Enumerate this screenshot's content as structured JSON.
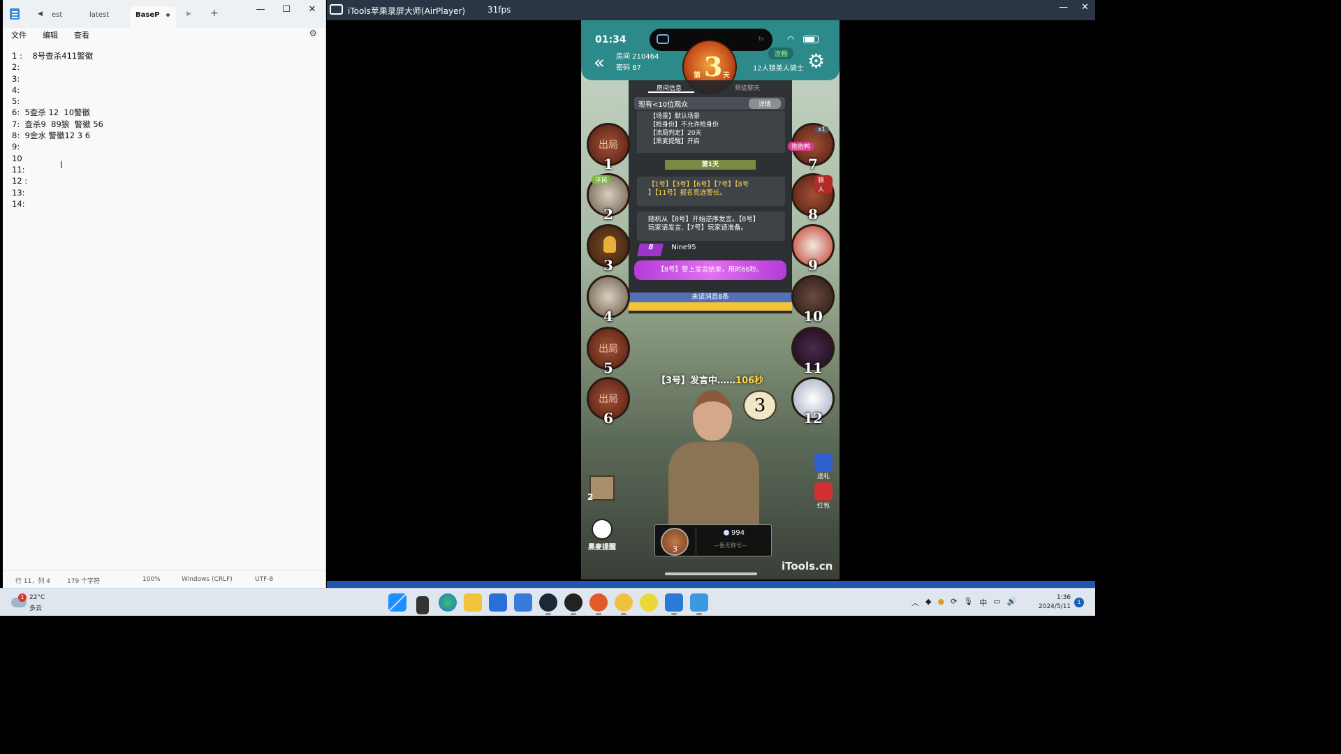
{
  "notepad": {
    "tabs": [
      "est",
      "latest",
      "BaseP"
    ],
    "menu": [
      "文件",
      "编辑",
      "查看"
    ],
    "lines": [
      "1 :    8号查杀411警徽",
      "2:",
      "3:",
      "4:",
      "5:",
      "6:  5查杀 12  10警徽",
      "7:  查杀9  89狼  警徽 56",
      "8:  9金水 警徽12 3 6",
      "9:",
      "10",
      "11:",
      "12 :",
      "13:",
      "14:"
    ],
    "status": {
      "position": "行 11，列 4",
      "chars": "179 个字符",
      "zoom": "100%",
      "line_ending": "Windows (CRLF)",
      "encoding": "UTF-8"
    }
  },
  "mirror": {
    "title": "iTools苹果录屏大师(AirPlayer)",
    "fps": "31fps"
  },
  "phone": {
    "time": "01:34",
    "island_label": "tv",
    "room": "房间 210464",
    "password": "密码 87",
    "day_prefix": "第",
    "day_number": "3",
    "day_suffix": "天",
    "network": "流畅",
    "mode": "12人狼美人骑士",
    "tab_room_info": "房间信息",
    "tab_chat": "师徒聊天",
    "audience": "现有<10位观众",
    "detail_button": "详情",
    "rules": [
      "【场景】默认场景",
      "【抢身份】不允许抢身份",
      "【流局判定】20天",
      "【黑麦提醒】开启"
    ],
    "day_banner": "第1天",
    "msg1_line1": "【1号】【3号】【6号】【7号】【8号",
    "msg1_line2": "】【11号】报名竞选警长。",
    "msg2_line1": "随机从【8号】开始逆序发言。【8号】",
    "msg2_line2": "玩家请发言,【7号】玩家请准备。",
    "speaker_number": "8",
    "speaker_name": "Nine95",
    "ended_text": "【8号】警上发言结束，用时66秒。",
    "unread": "未读消息8条",
    "speaking_label": "【3号】发言中……",
    "speaking_seconds": "106秒",
    "bubble_number": "3",
    "seats_left": [
      {
        "n": "1",
        "out": "出局"
      },
      {
        "n": "2",
        "tag": "平民"
      },
      {
        "n": "3"
      },
      {
        "n": "4"
      },
      {
        "n": "5",
        "out": "出局"
      },
      {
        "n": "6",
        "out": "出局"
      }
    ],
    "seats_right": [
      {
        "n": "7",
        "tag": "抱抱鸭",
        "badge": "x1"
      },
      {
        "n": "8",
        "tag": "狼人"
      },
      {
        "n": "9"
      },
      {
        "n": "10"
      },
      {
        "n": "11"
      },
      {
        "n": "12"
      }
    ],
    "role_count": "2",
    "gift": "送礼",
    "red_packet": "红包",
    "mute_reminder": "黑麦提醒",
    "profile_seat": "3",
    "profile_coins": "994",
    "profile_title": "—暂无称号—",
    "watermark": "iTools.cn"
  },
  "taskbar": {
    "weather_temp": "22°C",
    "weather_desc": "多云",
    "weather_badge": "1",
    "ime": "中",
    "time": "1:36",
    "date": "2024/5/11",
    "notification_count": "1"
  },
  "colors": {
    "teal_header": "#2d8a8a",
    "purple_speaker": "#9b36c9",
    "taskbar": "#dfe6ee",
    "mirror_titlebar": "#2a3645"
  }
}
